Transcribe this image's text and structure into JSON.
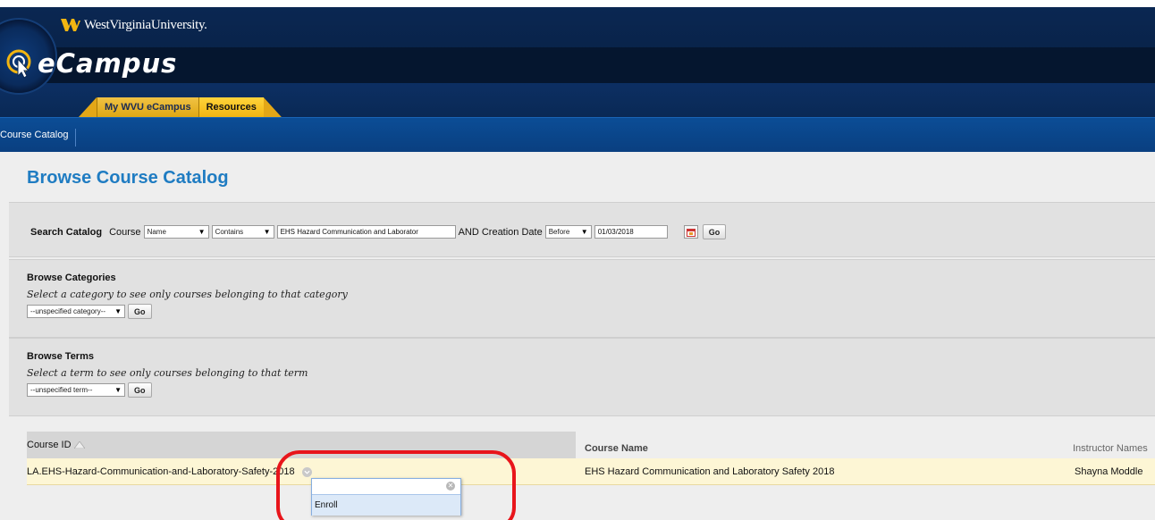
{
  "header": {
    "university": "WestVirginiaUniversity.",
    "app_name": "eCampus",
    "tabs": [
      {
        "label": "My WVU eCampus",
        "active": false
      },
      {
        "label": "Resources",
        "active": true
      }
    ],
    "nav_link": "Course Catalog"
  },
  "page_title": "Browse Course Catalog",
  "search": {
    "label": "Search Catalog",
    "field_label": "Course",
    "field_select": "Name",
    "operator_select": "Contains",
    "query_value": "EHS Hazard Communication and Laborator",
    "date_label": "AND Creation Date",
    "date_operator": "Before",
    "date_value": "01/03/2018",
    "go_label": "Go"
  },
  "browse_categories": {
    "title": "Browse Categories",
    "description": "Select a category to see only courses belonging to that category",
    "select_value": "--unspecified category--",
    "go_label": "Go"
  },
  "browse_terms": {
    "title": "Browse Terms",
    "description": "Select a term to see only courses belonging to that term",
    "select_value": "--unspecified term--",
    "go_label": "Go"
  },
  "table": {
    "columns": {
      "course_id": "Course ID",
      "course_name": "Course Name",
      "instructor": "Instructor Names"
    },
    "rows": [
      {
        "course_id": "LA.EHS-Hazard-Communication-and-Laboratory-Safety-2018",
        "course_name": "EHS Hazard Communication and Laboratory Safety 2018",
        "instructor": "Shayna Moddle"
      }
    ]
  },
  "context_menu": {
    "items": [
      "Enroll"
    ]
  },
  "colors": {
    "header_dark": "#082043",
    "nav_blue": "#0b4d96",
    "tab_gold": "#f2b511",
    "title_blue": "#1f7cc2",
    "highlight_red": "#e8151b",
    "row_highlight": "#fdf6d5"
  }
}
